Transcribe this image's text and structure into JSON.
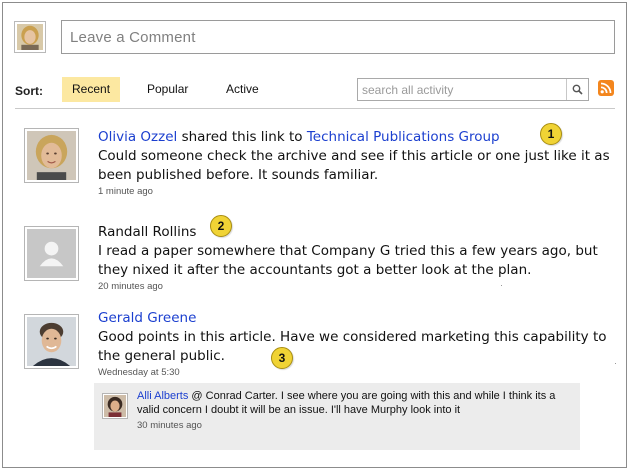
{
  "composer": {
    "placeholder": "Leave a Comment"
  },
  "sort": {
    "label": "Sort:",
    "options": [
      "Recent",
      "Popular",
      "Active"
    ],
    "active": "Recent"
  },
  "search": {
    "placeholder": "search all activity"
  },
  "feed": [
    {
      "name": "Olivia Ozzel",
      "action": "shared this link to",
      "target": "Technical Publications Group",
      "message": "Could someone check the archive and see if this article or one just like it as been published before. It sounds familiar.",
      "time": "1 minute ago",
      "marker": "1"
    },
    {
      "name": "Randall Rollins",
      "message": "I read a paper somewhere that Company G tried this a few years ago, but they nixed it after the accountants got a better look at the plan.",
      "time": "20 minutes ago",
      "marker": "2"
    },
    {
      "name": "Gerald Greene",
      "message": "Good points in this article. Have we considered marketing this capability to the general public.",
      "time": "Wednesday at 5:30",
      "marker": "3"
    }
  ],
  "reply": {
    "name": "Alli Alberts",
    "message": "@ Conrad Carter.  I see where you are going with this and while I think its a valid concern I doubt it will be an issue.  I'll have Murphy look into it",
    "time": "30 minutes ago"
  },
  "colors": {
    "link": "#1b3fcf",
    "active_sort_bg": "#fce8a1",
    "marker": "#f0d335",
    "rss": "#f3861e",
    "reply_bg": "#ececec"
  }
}
